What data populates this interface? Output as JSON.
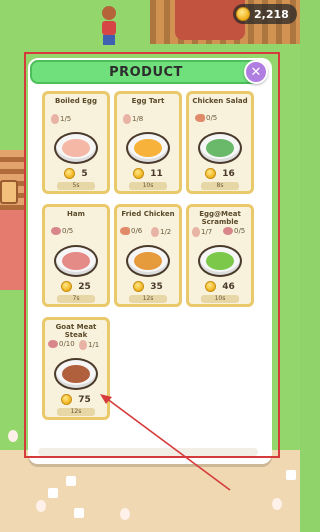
{
  "hud": {
    "coins": "2,218"
  },
  "panel": {
    "title": "PRODUCT",
    "close_icon": "close-x-icon",
    "cards": [
      {
        "name": "Boiled Egg",
        "ingredients": [
          {
            "icon": "egg",
            "count": "1/5"
          }
        ],
        "price": "5",
        "time": "5s",
        "dish": "boiled-egg",
        "food_color": "#f5b7a6"
      },
      {
        "name": "Egg Tart",
        "ingredients": [
          {
            "icon": "egg",
            "count": "1/8"
          }
        ],
        "price": "11",
        "time": "10s",
        "dish": "egg-tart",
        "food_color": "#f6b23a"
      },
      {
        "name": "Chicken Salad",
        "ingredients": [
          {
            "icon": "drumstick",
            "count": "0/5"
          }
        ],
        "price": "16",
        "time": "8s",
        "dish": "chicken-salad",
        "food_color": "#6ab86a"
      },
      {
        "name": "Ham",
        "ingredients": [
          {
            "icon": "meat",
            "count": "0/5"
          }
        ],
        "price": "25",
        "time": "7s",
        "dish": "ham",
        "food_color": "#e48b88"
      },
      {
        "name": "Fried Chicken",
        "ingredients": [
          {
            "icon": "drumstick",
            "count": "0/6"
          },
          {
            "icon": "egg",
            "count": "1/2"
          }
        ],
        "price": "35",
        "time": "12s",
        "dish": "fried-chicken",
        "food_color": "#e59a3c"
      },
      {
        "name": "Egg@Meat Scramble",
        "ingredients": [
          {
            "icon": "egg",
            "count": "1/7"
          },
          {
            "icon": "meat",
            "count": "0/5"
          }
        ],
        "price": "46",
        "time": "10s",
        "dish": "egg-meat-scramble",
        "food_color": "#7cc84a"
      },
      {
        "name": "Goat Meat Steak",
        "ingredients": [
          {
            "icon": "meat",
            "count": "0/10"
          },
          {
            "icon": "egg",
            "count": "1/1"
          }
        ],
        "price": "75",
        "time": "12s",
        "dish": "goat-meat-steak",
        "food_color": "#b0603c"
      }
    ]
  },
  "annotation": {
    "color": "#d53b3b"
  }
}
